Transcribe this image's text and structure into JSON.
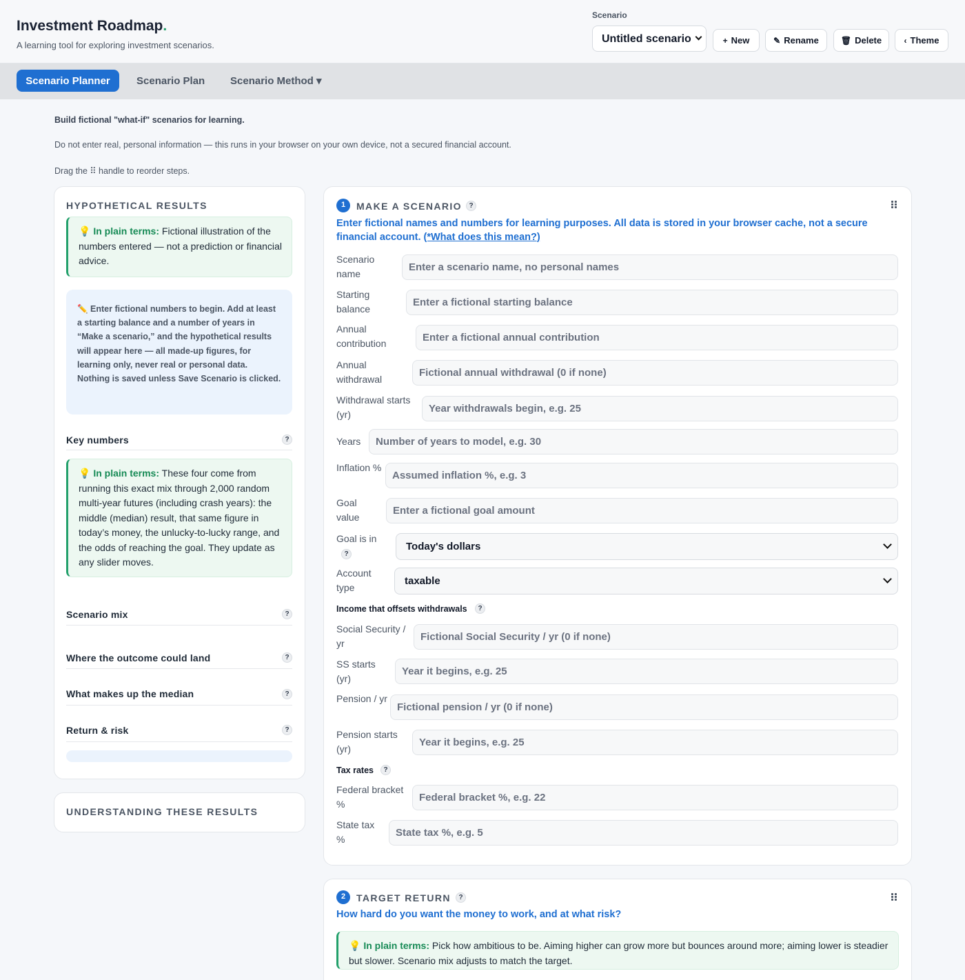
{
  "header": {
    "title": "Investment Roadmap",
    "title_dot": ".",
    "subtitle": "A learning tool for exploring investment scenarios.",
    "scenario_label": "Scenario",
    "scenario_selected": "Untitled scenario",
    "buttons": {
      "new": {
        "icon": "+",
        "label": "New"
      },
      "rename": {
        "icon": "✎",
        "label": "Rename"
      },
      "delete": {
        "icon": "🗑",
        "label": "Delete"
      },
      "theme": {
        "icon": "‹",
        "label": "Theme"
      }
    }
  },
  "nav": {
    "tabs": [
      {
        "label": "Scenario Planner"
      },
      {
        "label": "Scenario Plan"
      },
      {
        "label": "Scenario Method ▾"
      }
    ]
  },
  "intro": {
    "line1": "Build fictional \"what-if\" scenarios for learning.",
    "line2": "Do not enter real, personal information — this runs in your browser on your own device, not a secured financial account.",
    "line3": "Drag the ⠿ handle to reorder steps."
  },
  "results": {
    "heading": "HYPOTHETICAL RESULTS",
    "tip1_prefix": "💡 In plain terms:",
    "tip1_text": " Fictional illustration of the numbers entered — not a prediction or financial advice.",
    "info": "✏️ Enter fictional numbers to begin. Add at least a starting balance and a number of years in “Make a scenario,” and the hypothetical results will appear here — all made-up figures, for learning only, never real or personal data. Nothing is saved unless Save Scenario is clicked.",
    "key_numbers": "Key numbers",
    "tip2_prefix": "💡 In plain terms:",
    "tip2_text": " These four come from running this exact mix through 2,000 random multi-year futures (including crash years): the middle (median) result, that same figure in today’s money, the unlucky-to-lucky range, and the odds of reaching the goal. They update as any slider moves.",
    "sections": [
      "Scenario mix",
      "Where the outcome could land",
      "What makes up the median",
      "Return & risk"
    ],
    "q": "?"
  },
  "understanding": {
    "heading": "UNDERSTANDING THESE RESULTS"
  },
  "step1": {
    "number": "1",
    "heading": "MAKE A SCENARIO",
    "lead": "Enter fictional names and numbers for learning purposes. All data is stored in your browser cache, not a secure financial account. ",
    "lead_link": "(*What does this mean?)",
    "fields": [
      {
        "label": "Scenario name",
        "placeholder": "Enter a scenario name, no personal names"
      },
      {
        "label": "Starting balance",
        "placeholder": "Enter a fictional starting balance"
      },
      {
        "label": "Annual contribution",
        "placeholder": "Enter a fictional annual contribution"
      },
      {
        "label": "Annual withdrawal",
        "placeholder": "Fictional annual withdrawal (0 if none)"
      },
      {
        "label": "Withdrawal starts (yr)",
        "placeholder": "Year withdrawals begin, e.g. 25"
      },
      {
        "label": "Years",
        "placeholder": "Number of years to model, e.g. 30"
      },
      {
        "label": "Inflation %",
        "placeholder": "Assumed inflation %, e.g. 3"
      },
      {
        "label": "Goal value",
        "placeholder": "Enter a fictional goal amount"
      }
    ],
    "goal_is_in": {
      "label": "Goal is in",
      "value": "Today's dollars"
    },
    "account_type": {
      "label": "Account type",
      "value": "taxable"
    },
    "income_heading": "Income that offsets withdrawals",
    "income_fields": [
      {
        "label": "Social Security / yr",
        "placeholder": "Fictional Social Security / yr (0 if none)"
      },
      {
        "label": "SS starts (yr)",
        "placeholder": "Year it begins, e.g. 25"
      },
      {
        "label": "Pension / yr",
        "placeholder": "Fictional pension / yr (0 if none)"
      },
      {
        "label": "Pension starts (yr)",
        "placeholder": "Year it begins, e.g. 25"
      }
    ],
    "tax_heading": "Tax rates",
    "tax_fields": [
      {
        "label": "Federal bracket %",
        "placeholder": "Federal bracket %, e.g. 22"
      },
      {
        "label": "State tax %",
        "placeholder": "State tax %, e.g. 5"
      }
    ]
  },
  "step2": {
    "number": "2",
    "heading": "TARGET RETURN",
    "lead": "How hard do you want the money to work, and at what risk?",
    "tip_prefix": "💡 In plain terms:",
    "tip_text": " Pick how ambitious to be. Aiming higher can grow more but bounces around more; aiming lower is steadier but slower. Scenario mix adjusts to match the target."
  }
}
